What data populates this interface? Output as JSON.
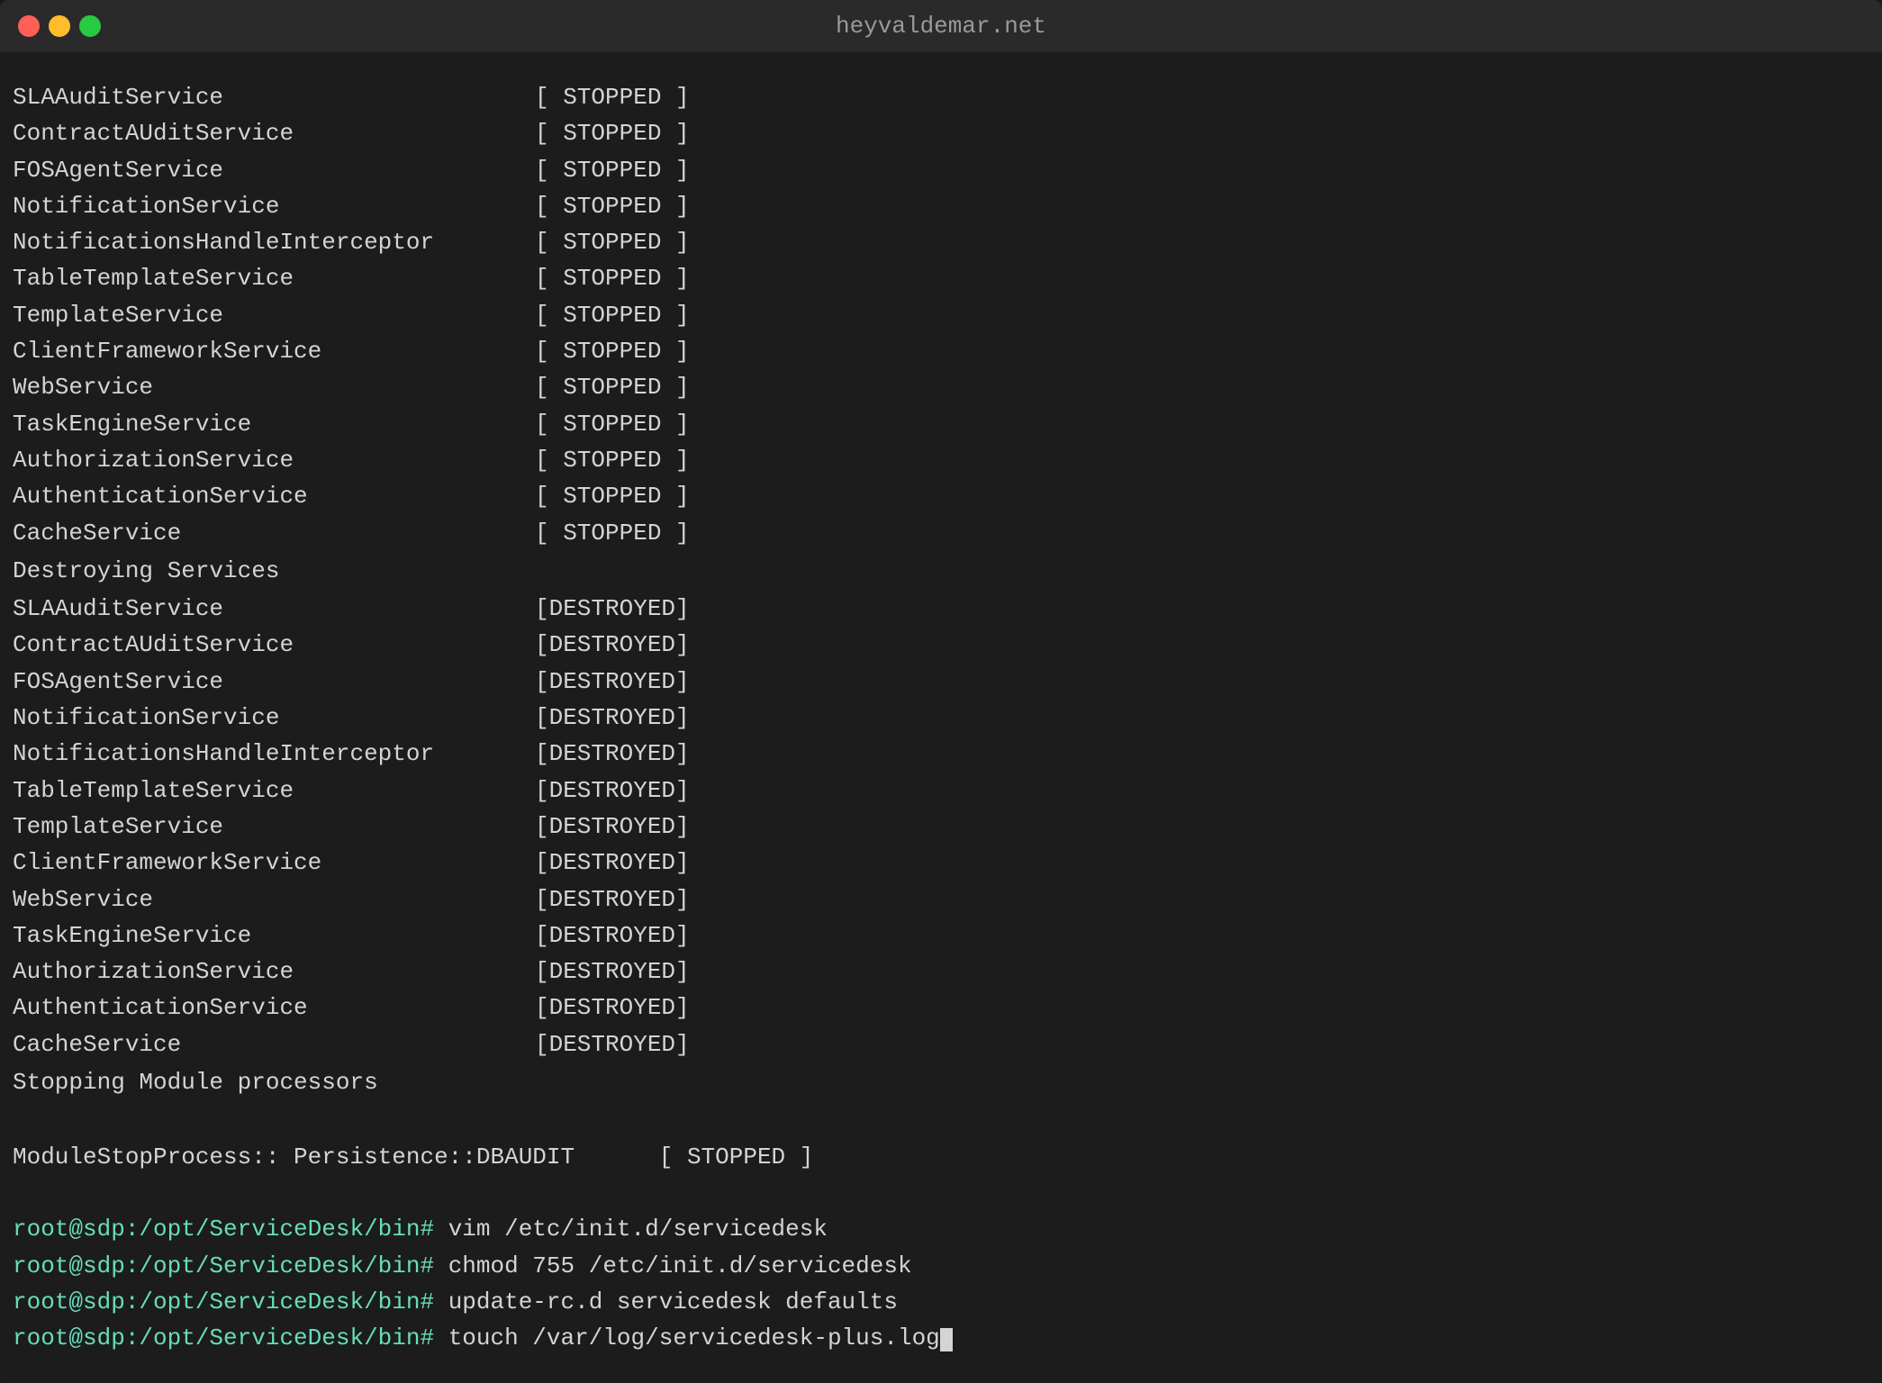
{
  "window": {
    "title": "heyvaldemar.net"
  },
  "traffic_lights": {
    "close_label": "close",
    "minimize_label": "minimize",
    "maximize_label": "maximize"
  },
  "stopped_services": [
    "SLAAuditService",
    "ContractAUditService",
    "FOSAgentService",
    "NotificationService",
    "NotificationsHandleInterceptor",
    "TableTemplateService",
    "TemplateService",
    "ClientFrameworkService",
    "WebService",
    "TaskEngineService",
    "AuthorizationService",
    "AuthenticationService",
    "CacheService"
  ],
  "stopped_status": "[ STOPPED ]",
  "section_header": "Destroying Services",
  "destroyed_services": [
    "SLAAuditService",
    "ContractAUditService",
    "FOSAgentService",
    "NotificationService",
    "NotificationsHandleInterceptor",
    "TableTemplateService",
    "TemplateService",
    "ClientFrameworkService",
    "WebService",
    "TaskEngineService",
    "AuthorizationService",
    "AuthenticationService",
    "CacheService"
  ],
  "destroyed_status": "[DESTROYED]",
  "stopping_module": "Stopping Module processors",
  "module_stop_line": "ModuleStopProcess:: Persistence::DBAUDIT",
  "module_stop_status": "[ STOPPED ]",
  "prompt": "root@sdp:/opt/ServiceDesk/bin#",
  "commands": [
    "vim /etc/init.d/servicedesk",
    "chmod 755 /etc/init.d/servicedesk",
    "update-rc.d servicedesk defaults",
    "touch /var/log/servicedesk-plus.log"
  ]
}
